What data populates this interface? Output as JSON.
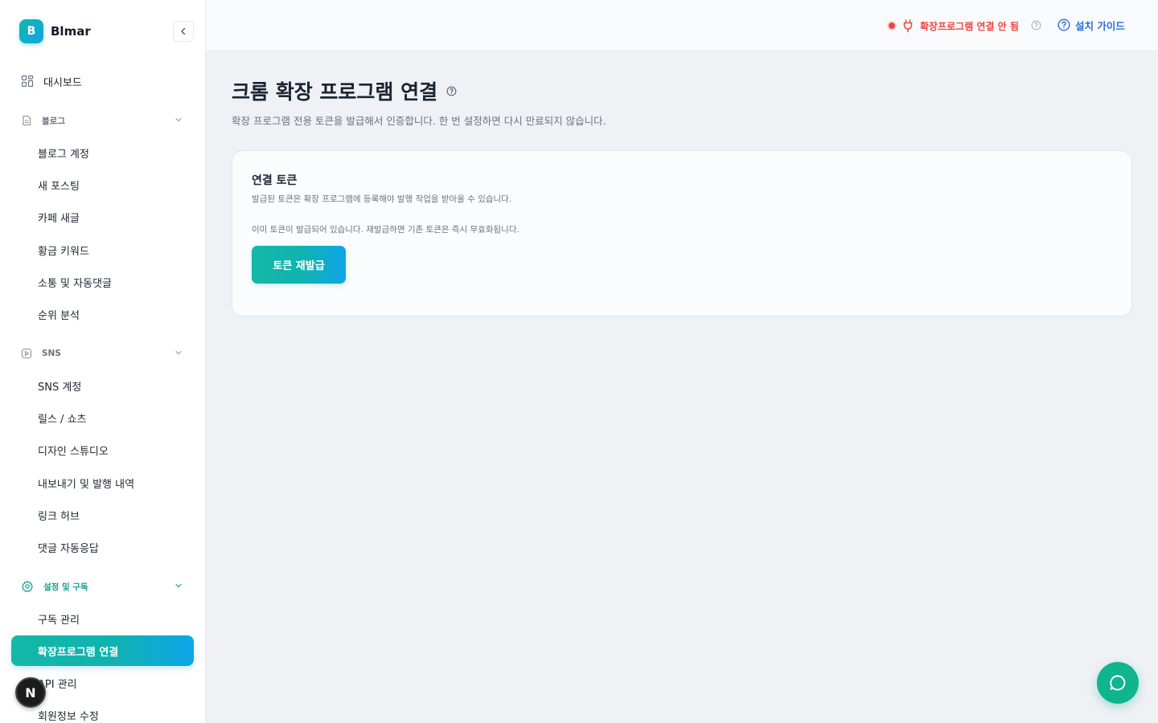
{
  "brand": {
    "logo_letter": "B",
    "name": "Blmar"
  },
  "sidebar": {
    "dashboard": "대시보드",
    "blog": {
      "label": "블로그",
      "items": [
        "블로그 계정",
        "새 포스팅",
        "카페 새글",
        "황금 키워드",
        "소통 및 자동댓글",
        "순위 분석"
      ]
    },
    "sns": {
      "label": "SNS",
      "items": [
        "SNS 계정",
        "릴스 / 쇼츠",
        "디자인 스튜디오",
        "내보내기 및 발행 내역",
        "링크 허브",
        "댓글 자동응답"
      ]
    },
    "settings": {
      "label": "설정 및 구독",
      "items": [
        "구독 관리",
        "확장프로그램 연결",
        "API 관리",
        "회원정보 수정"
      ],
      "active_index": 1
    },
    "n_badge": "N"
  },
  "topbar": {
    "status_label": "확장프로그램 연결 안 됨",
    "guide_label": "설치 가이드"
  },
  "page": {
    "title": "크롬 확장 프로그램 연결",
    "subtitle": "확장 프로그램 전용 토큰을 발급해서 인증합니다. 한 번 설정하면 다시 만료되지 않습니다."
  },
  "card": {
    "title": "연결 토큰",
    "description": "발급된 토큰은 확장 프로그램에 등록해야 발행 작업을 받아올 수 있습니다.",
    "note": "이미 토큰이 발급되어 있습니다. 재발급하면 기존 토큰은 즉시 무효화됩니다.",
    "button_label": "토큰 재발급"
  },
  "colors": {
    "accent_start": "#14b8a6",
    "accent_end": "#0ea5e9",
    "status_error": "#ef4444",
    "link_blue": "#2b6fd6",
    "chat_green": "#10b48f"
  },
  "icons": {
    "dashboard": "grid-icon",
    "blog": "document-icon",
    "sns": "play-icon",
    "settings": "gear-icon",
    "status": "plug-icon",
    "help": "question-circle-icon",
    "chat": "chat-bubble-icon"
  }
}
